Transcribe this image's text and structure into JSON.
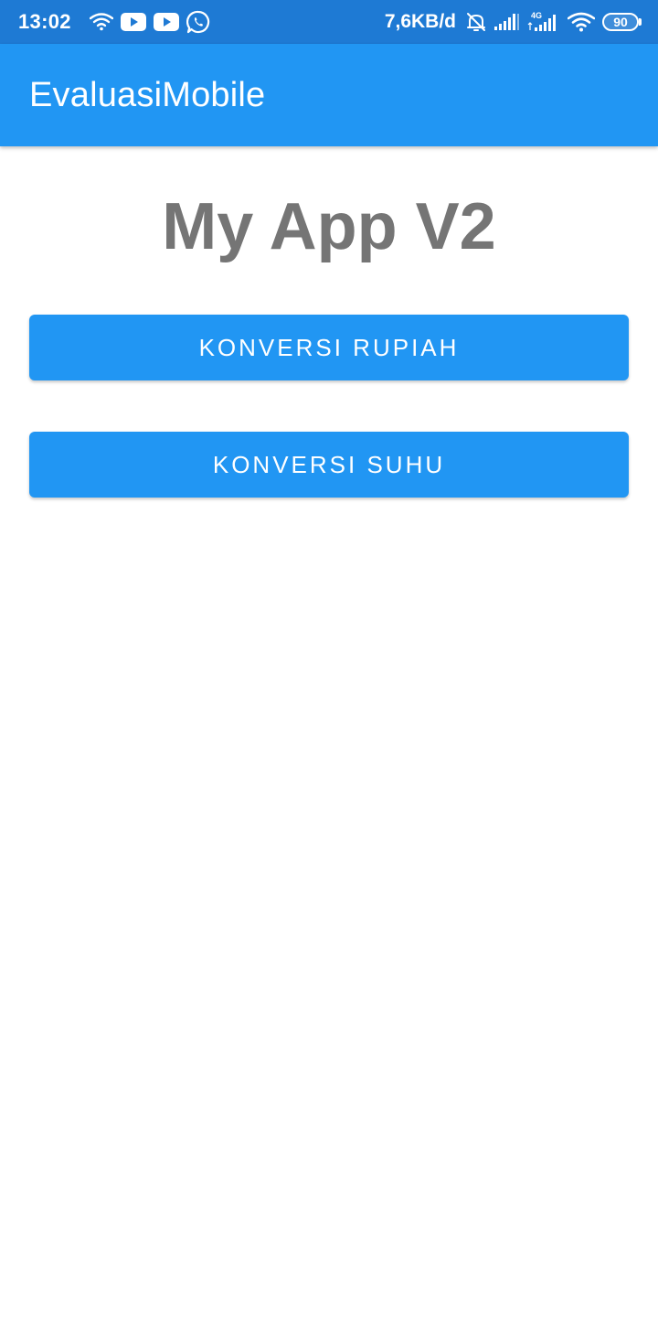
{
  "status_bar": {
    "time": "13:02",
    "network_speed": "7,6KB/d",
    "network_type": "4G",
    "battery_level": "90",
    "left_icons": [
      "wifi-icon",
      "youtube-icon",
      "youtube-icon",
      "whatsapp-icon"
    ],
    "right_icons": [
      "alarm-off-icon",
      "signal-icon",
      "signal-4g-icon",
      "wifi-icon",
      "battery-icon"
    ]
  },
  "app_bar": {
    "title": "EvaluasiMobile",
    "color": "#2196f3"
  },
  "main": {
    "heading": "My App V2",
    "buttons": [
      {
        "label": "KONVERSI RUPIAH"
      },
      {
        "label": "KONVERSI SUHU"
      }
    ]
  },
  "colors": {
    "status_bar": "#1e7ad4",
    "primary": "#2196f3",
    "heading_text": "#757575",
    "background": "#ffffff"
  }
}
